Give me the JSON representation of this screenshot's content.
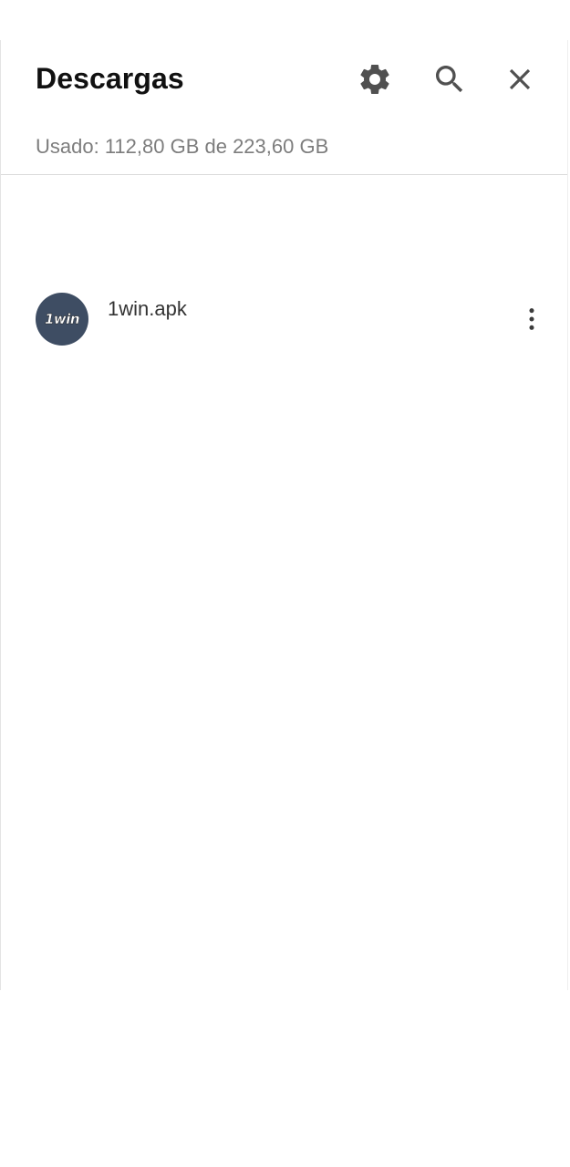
{
  "header": {
    "title": "Descargas",
    "storage_usage": "Usado: 112,80 GB de 223,60 GB",
    "actions": [
      {
        "icon": "gear-icon"
      },
      {
        "icon": "search-icon"
      },
      {
        "icon": "close-icon"
      }
    ]
  },
  "downloads": [
    {
      "file_name": "1win.apk",
      "icon_logo_text": "1win",
      "menu_icon": "more-vert-icon"
    }
  ],
  "colors": {
    "title": "#111111",
    "secondary_text": "#7d7d7d",
    "icon": "#505050",
    "avatar_bg": "#3e4d63",
    "divider": "#dadada"
  }
}
